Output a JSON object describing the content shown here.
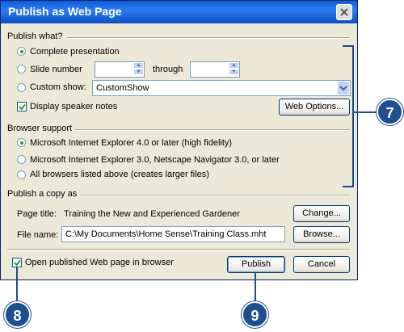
{
  "window": {
    "title": "Publish as Web Page"
  },
  "publish_what": {
    "heading": "Publish what?",
    "complete": "Complete presentation",
    "slide_number": "Slide number",
    "through": "through",
    "custom_show": "Custom show:",
    "custom_show_value": "CustomShow",
    "speaker_notes": "Display speaker notes",
    "web_options": "Web Options..."
  },
  "browser_support": {
    "heading": "Browser support",
    "ie4": "Microsoft Internet Explorer 4.0 or later (high fidelity)",
    "ie3": "Microsoft Internet Explorer 3.0, Netscape Navigator 3.0, or later",
    "all": "All browsers listed above (creates larger files)"
  },
  "publish_copy": {
    "heading": "Publish a copy as",
    "page_title_label": "Page title:",
    "page_title_value": "Training the New and Experienced Gardener",
    "change": "Change...",
    "file_name_label": "File name:",
    "file_name_value": "C:\\My Documents\\Home Sense\\Training Class.mht",
    "browse": "Browse..."
  },
  "footer": {
    "open_in_browser": "Open published Web page in browser",
    "publish": "Publish",
    "cancel": "Cancel"
  },
  "callouts": {
    "c7": "7",
    "c8": "8",
    "c9": "9"
  },
  "colors": {
    "accent": "#1f4e8f",
    "radio_dot": "#21a121"
  }
}
